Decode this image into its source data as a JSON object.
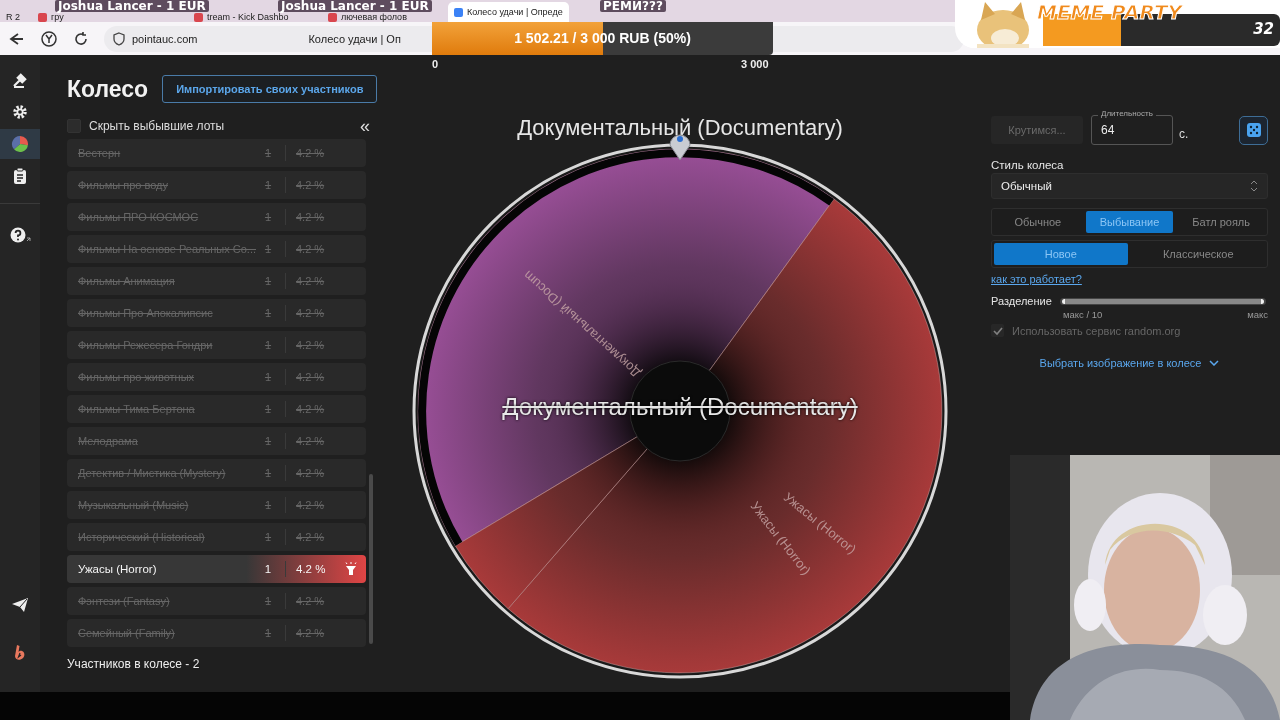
{
  "browser": {
    "tabs": [
      {
        "label": "R 2",
        "selected": false
      },
      {
        "label": "гру",
        "selected": false
      },
      {
        "label": "tream - Kick Dashbo",
        "selected": false
      },
      {
        "label": "лючевая фолов",
        "selected": false
      },
      {
        "label": "Колесо удачи | Опреде",
        "selected": true
      }
    ],
    "address": "pointauc.com",
    "page_title": "Колесо удачи | Оп"
  },
  "stream_overlay": {
    "alerts": [
      "Joshua Lancer - 1 EUR",
      "Joshua Lancer - 1 EUR",
      "РЕМИ???"
    ],
    "goal": {
      "text": "1 502.21 / 3 000 RUB (50%)",
      "level": 0.5,
      "start": "0",
      "end": "3 000"
    },
    "banner": {
      "title": "MEME PARTY",
      "count": "32"
    }
  },
  "sidebar": {
    "items": [
      {
        "selected": false
      },
      {
        "selected": false
      },
      {
        "selected": true
      },
      {
        "selected": false
      },
      {
        "selected": false
      }
    ]
  },
  "wheel_panel": {
    "title": "Колесо",
    "import_button": "Импортировать своих участников",
    "hide_eliminated": {
      "label": "Скрыть выбывшие лоты",
      "checked": false
    },
    "collapse": "«",
    "lots": [
      {
        "name": "Вестерн",
        "count": "1",
        "share": "4.2 %",
        "eliminated": true,
        "selected": false
      },
      {
        "name": "Фильмы про воду",
        "count": "1",
        "share": "4.2 %",
        "eliminated": true,
        "selected": false
      },
      {
        "name": "Фильмы ПРО КОСМОС",
        "count": "1",
        "share": "4.2 %",
        "eliminated": true,
        "selected": false
      },
      {
        "name": "Фильмы На основе Реальных Со...",
        "count": "1",
        "share": "4.2 %",
        "eliminated": true,
        "selected": false
      },
      {
        "name": "Фильмы Анимация",
        "count": "1",
        "share": "4.2 %",
        "eliminated": true,
        "selected": false
      },
      {
        "name": "Фильмы Про Апокалипсис",
        "count": "1",
        "share": "4.2 %",
        "eliminated": true,
        "selected": false
      },
      {
        "name": "Фильмы Режесера Гондри",
        "count": "1",
        "share": "4.2 %",
        "eliminated": true,
        "selected": false
      },
      {
        "name": "Фильмы про животных",
        "count": "1",
        "share": "4.2 %",
        "eliminated": true,
        "selected": false
      },
      {
        "name": "Фильмы Тима Бертона",
        "count": "1",
        "share": "4.2 %",
        "eliminated": true,
        "selected": false
      },
      {
        "name": "Мелодрама",
        "count": "1",
        "share": "4.2 %",
        "eliminated": true,
        "selected": false
      },
      {
        "name": "Детектив / Мистика (Mystery)",
        "count": "1",
        "share": "4.2 %",
        "eliminated": true,
        "selected": false
      },
      {
        "name": "Музыкальный (Music)",
        "count": "1",
        "share": "4.2 %",
        "eliminated": true,
        "selected": false
      },
      {
        "name": "Исторический (Historical)",
        "count": "1",
        "share": "4.2 %",
        "eliminated": true,
        "selected": false
      },
      {
        "name": "Ужасы (Horror)",
        "count": "1",
        "share": "4.2 %",
        "eliminated": false,
        "selected": true
      },
      {
        "name": "Фэнтези (Fantasy)",
        "count": "1",
        "share": "4.2 %",
        "eliminated": true,
        "selected": false
      },
      {
        "name": "Семейный (Family)",
        "count": "1",
        "share": "4.2 %",
        "eliminated": true,
        "selected": false
      }
    ],
    "footer": "Участников в колесе - 2"
  },
  "wheel": {
    "title": "Документальный (Documentary)",
    "center_text": "Документальный (Documentary)",
    "segments": [
      {
        "label": "Документальный (Docum",
        "color": "#9a4f98"
      },
      {
        "label": "Ужасы (Horror)",
        "color": "#a83a3a"
      },
      {
        "label": "Ужасы (Horror)",
        "color": "#a83a3a"
      }
    ]
  },
  "settings": {
    "spin_button": {
      "label": "Крутимся...",
      "disabled": true
    },
    "duration": {
      "label": "Длительность",
      "value": "64",
      "unit": "с."
    },
    "style": {
      "label": "Стиль колеса",
      "value": "Обычный"
    },
    "modes": [
      {
        "label": "Обычное",
        "selected": false
      },
      {
        "label": "Выбывание",
        "selected": true
      },
      {
        "label": "Батл рояль",
        "selected": false
      }
    ],
    "variants": [
      {
        "label": "Новое",
        "selected": true
      },
      {
        "label": "Классическое",
        "selected": false
      }
    ],
    "help_link": "как это работает?",
    "split": {
      "label": "Разделение",
      "level": 1,
      "min_label": "макс / 10",
      "max_label": "макс"
    },
    "random_org": {
      "label": "Использовать сервис random.org",
      "checked": true,
      "disabled": true
    },
    "image_picker": "Выбрать изображение в колесе"
  }
}
